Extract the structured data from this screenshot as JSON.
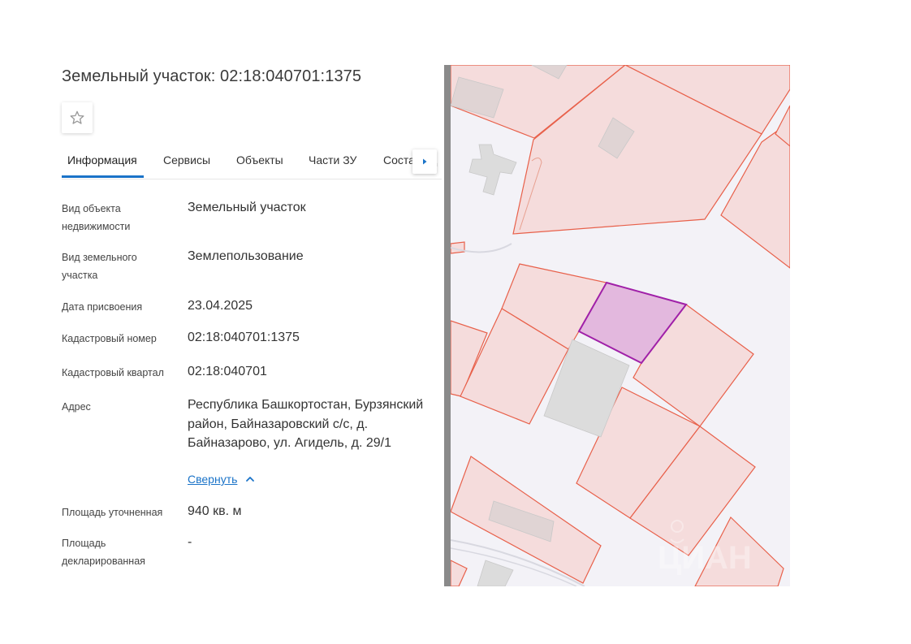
{
  "header": {
    "title": "Земельный участок: 02:18:040701:1375",
    "favorite_icon": "star-outline-icon"
  },
  "tabs": [
    {
      "label": "Информация",
      "active": true
    },
    {
      "label": "Сервисы",
      "active": false
    },
    {
      "label": "Объекты",
      "active": false
    },
    {
      "label": "Части ЗУ",
      "active": false
    },
    {
      "label": "Состав ГД",
      "active": false
    }
  ],
  "tabs_next_icon": "caret-right-icon",
  "info": {
    "object_type": {
      "label": "Вид объекта недвижимости",
      "value": "Земельный участок"
    },
    "land_type": {
      "label": "Вид земельного участка",
      "value": "Землепользование"
    },
    "assign_date": {
      "label": "Дата присвоения",
      "value": "23.04.2025"
    },
    "cadastral_number": {
      "label": "Кадастровый номер",
      "value": "02:18:040701:1375"
    },
    "cadastral_quarter": {
      "label": "Кадастровый квартал",
      "value": "02:18:040701"
    },
    "address": {
      "label": "Адрес",
      "value": "Республика Башкортостан, Бурзянский район, Байназаровский с/с, д. Байназарово, ул. Агидель, д. 29/1"
    },
    "collapse_link": "Свернуть",
    "area_specified": {
      "label": "Площадь уточненная",
      "value": "940 кв. м"
    },
    "area_declared": {
      "label": "Площадь декларированная",
      "value": "-"
    }
  },
  "map": {
    "watermark": "ЦИАН",
    "colors": {
      "parcel_fill": "#f5dcdc",
      "parcel_stroke": "#e8604a",
      "selected_fill": "#e3b8de",
      "selected_stroke": "#a020a8",
      "building_fill": "#dcdcdc",
      "background": "#f3f2f7"
    }
  }
}
